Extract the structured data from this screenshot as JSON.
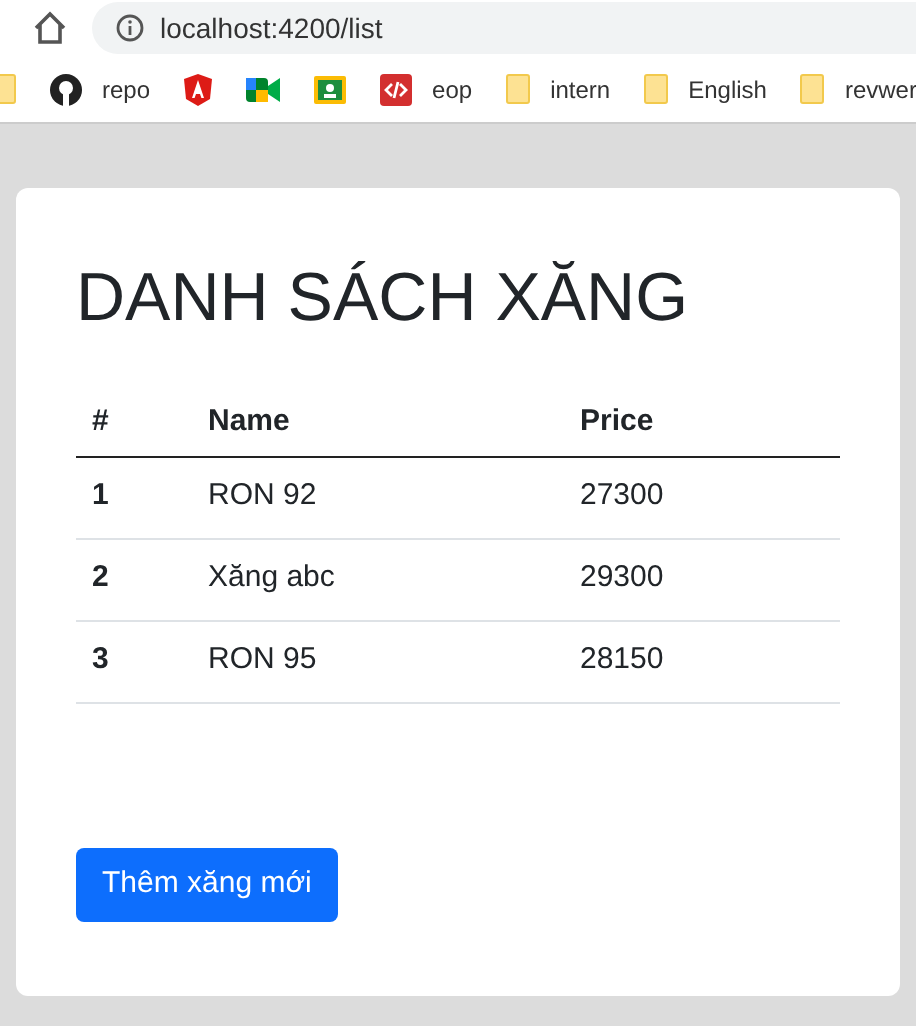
{
  "browser": {
    "url": "localhost:4200/list"
  },
  "bookmarks": [
    {
      "kind": "folder"
    },
    {
      "kind": "github",
      "label": "repo"
    },
    {
      "kind": "angular"
    },
    {
      "kind": "meet"
    },
    {
      "kind": "classroom"
    },
    {
      "kind": "code",
      "label": "eop"
    },
    {
      "kind": "folder",
      "label": "intern"
    },
    {
      "kind": "folder",
      "label": "English"
    },
    {
      "kind": "folder",
      "label": "revwer"
    }
  ],
  "page": {
    "title": "DANH SÁCH XĂNG",
    "table": {
      "columns": [
        "#",
        "Name",
        "Price"
      ],
      "rows": [
        [
          "1",
          "RON 92",
          "27300"
        ],
        [
          "2",
          "Xăng abc",
          "29300"
        ],
        [
          "3",
          "RON 95",
          "28150"
        ]
      ]
    },
    "button": "Thêm xăng mới"
  }
}
